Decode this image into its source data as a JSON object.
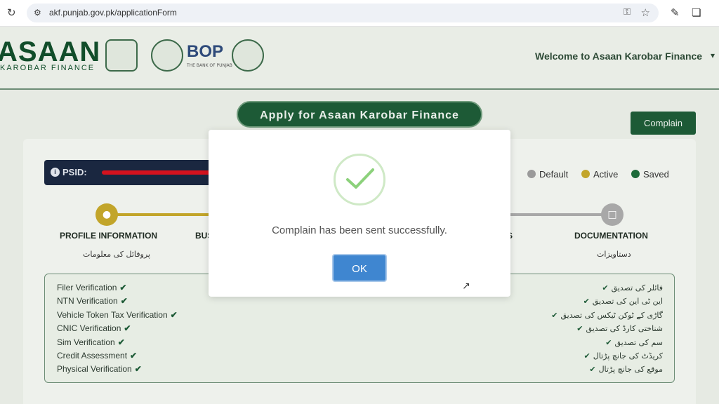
{
  "browser": {
    "url": "akf.punjab.gov.pk/applicationForm"
  },
  "header": {
    "logo_main": "ASAAN",
    "logo_sub": "KAROBAR FINANCE",
    "bop_label": "BOP",
    "bop_sub": "THE BANK OF PUNJAB",
    "welcome_text": "Welcome to Asaan Karobar Finance"
  },
  "main": {
    "apply_title": "Apply for Asaan Karobar Finance",
    "complain_label": "Complain",
    "psid_label": "PSID:"
  },
  "legend": [
    {
      "label": "Default",
      "color": "#9a9a9a"
    },
    {
      "label": "Active",
      "color": "#c2a52a"
    },
    {
      "label": "Saved",
      "color": "#1d6b3a"
    }
  ],
  "steps": [
    {
      "title": "PROFILE INFORMATION",
      "urdu": "پروفائل کی معلومات",
      "color": "#c2a52a"
    },
    {
      "title": "BUS",
      "urdu": "",
      "color": "#a8a8a8"
    },
    {
      "title": "S",
      "urdu": "",
      "color": "#a8a8a8"
    },
    {
      "title": "DOCUMENTATION",
      "urdu": "دستاویزات",
      "color": "#a8a8a8"
    }
  ],
  "verification_en": [
    "Filer Verification",
    "NTN Verification",
    "Vehicle Token Tax Verification",
    "CNIC Verification",
    "Sim Verification",
    "Credit Assessment",
    "Physical Verification"
  ],
  "verification_ur": [
    "فائلر کی تصدیق",
    "این ٹی این کی تصدیق",
    "گاڑی کے ٹوکن ٹیکس کی تصدیق",
    "شناختی کارڈ کی تصدیق",
    "سم کی تصدیق",
    "کریڈٹ کی جانچ پڑتال",
    "موقع کی جانچ پڑتال"
  ],
  "modal": {
    "message": "Complain has been sent successfully.",
    "ok_label": "OK",
    "success_color": "#5cb85c"
  }
}
